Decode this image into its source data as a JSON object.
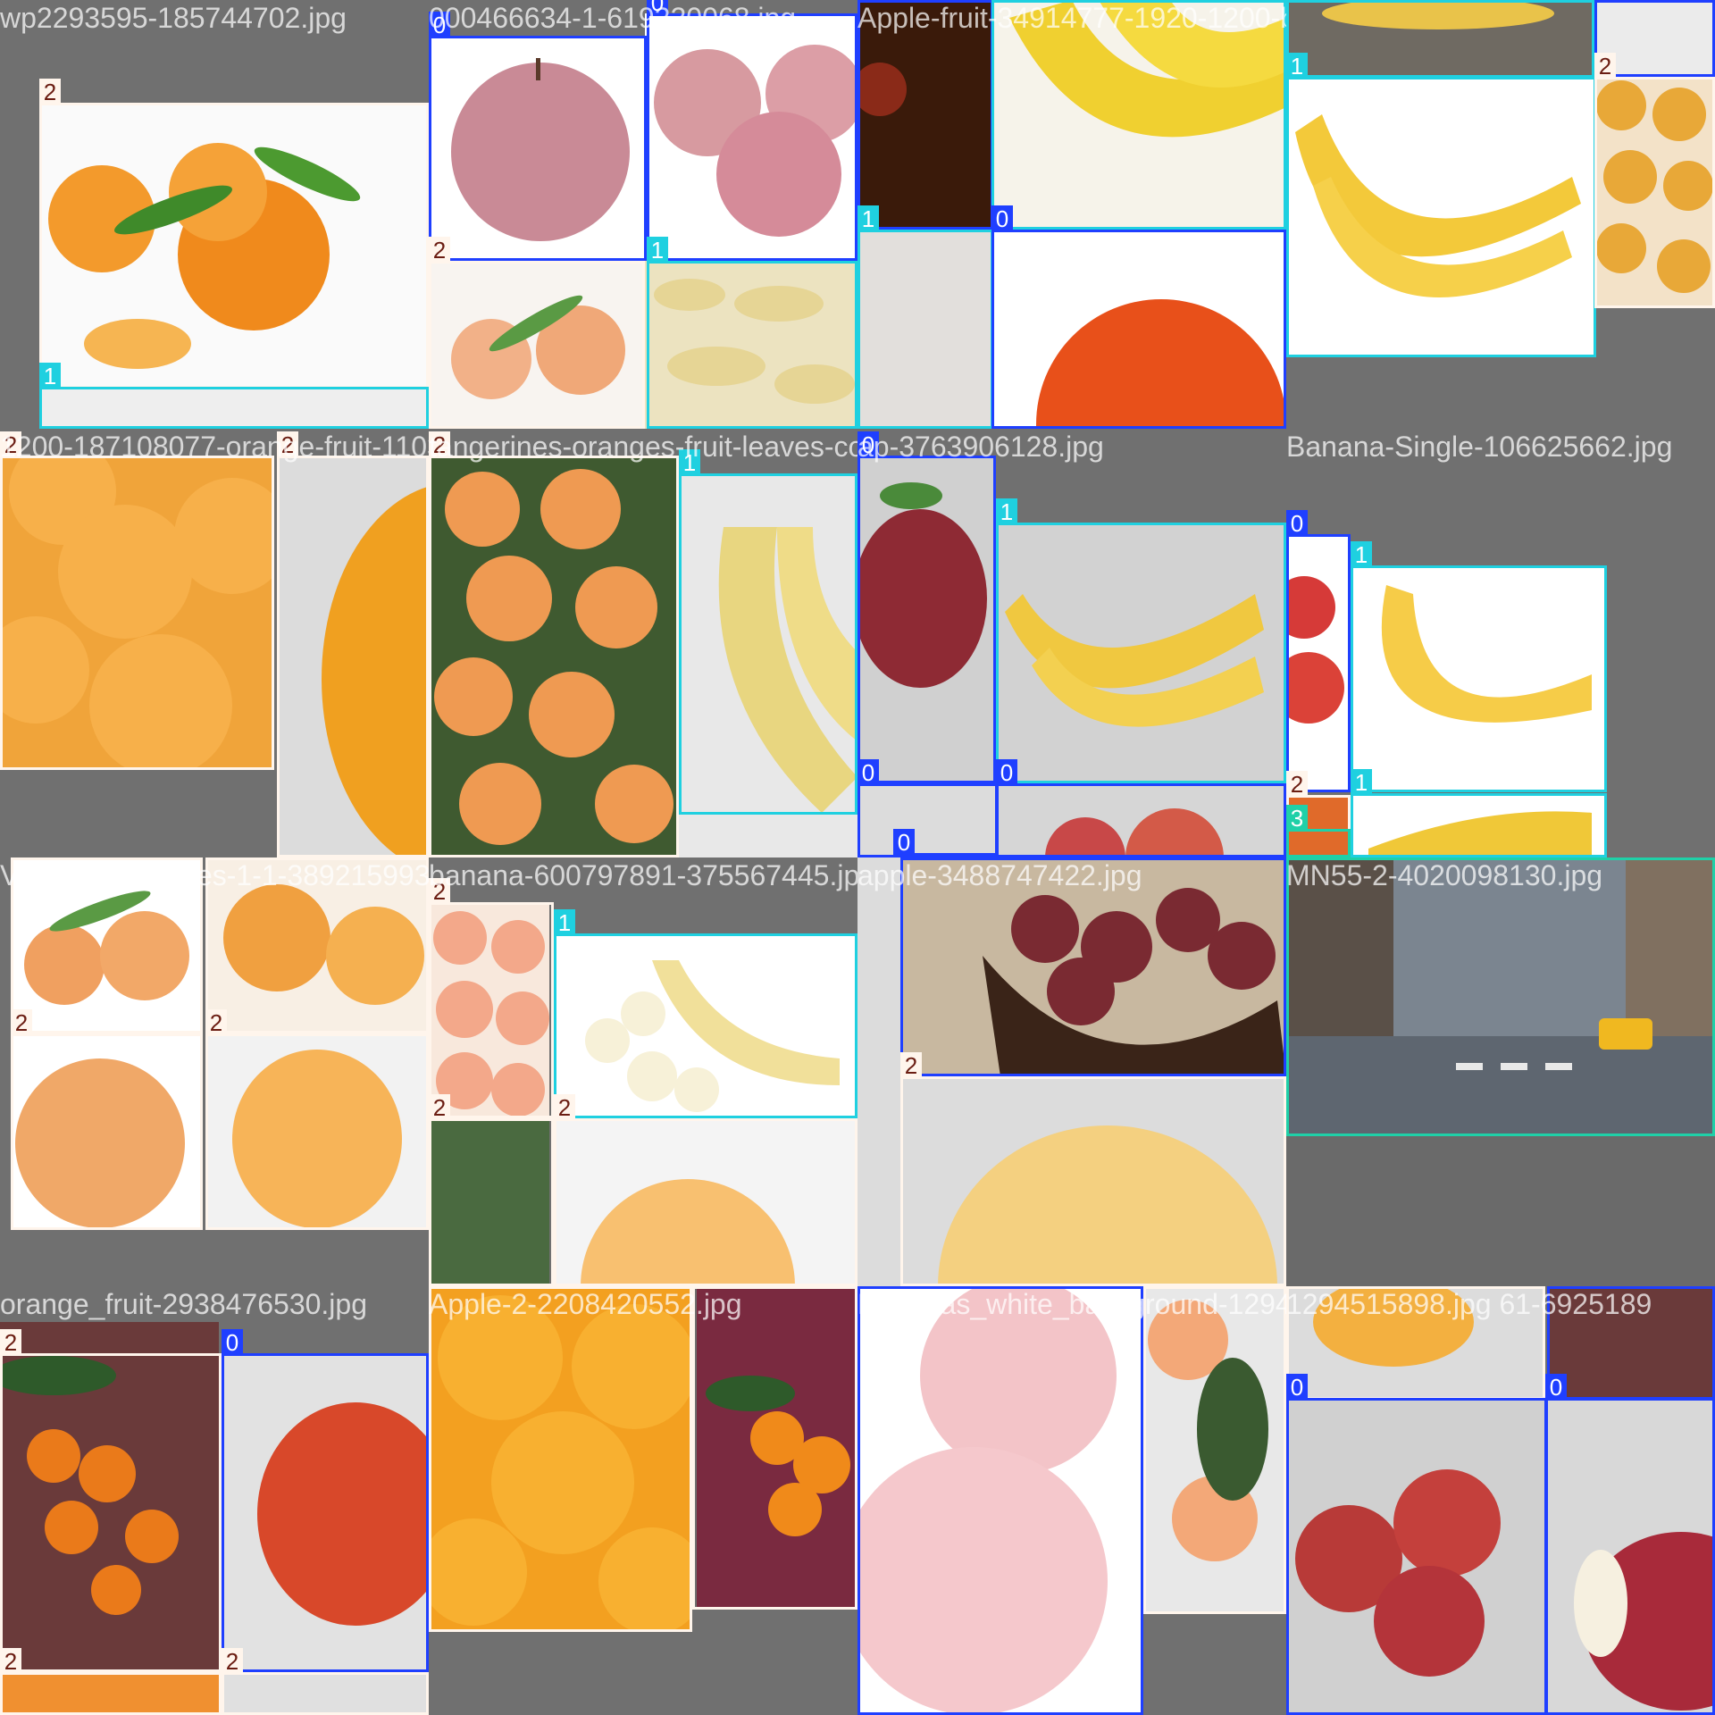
{
  "classes": {
    "0": {
      "label": "0",
      "color": "#1f3fff",
      "meaning": "apple"
    },
    "1": {
      "label": "1",
      "color": "#1fd0e0",
      "meaning": "banana"
    },
    "2": {
      "label": "2",
      "color": "#fff5ec",
      "meaning": "orange"
    },
    "3": {
      "label": "3",
      "color": "#1fd0a8",
      "meaning": "other"
    }
  },
  "tiles": [
    {
      "filename": "wp2293595-185744702.jpg",
      "row": 0,
      "col": 0
    },
    {
      "filename": "000466634-1-619220068.jpg",
      "row": 0,
      "col": 1
    },
    {
      "filename": "Apple-fruit-34914777-1920-1200-bananas-2702100.jpg",
      "row": 0,
      "col": 2
    },
    {
      "filename": "",
      "row": 0,
      "col": 3
    },
    {
      "filename": "1200-187108077-orange-fruit-1103748177.jpg",
      "row": 1,
      "col": 0
    },
    {
      "filename": "tangerines-oranges-fruit-leaves-compote",
      "row": 1,
      "col": 1
    },
    {
      "filename": "ap-3763906128.jpg",
      "row": 1,
      "col": 2
    },
    {
      "filename": "Banana-Single-106625662.jpg",
      "row": 1,
      "col": 3
    },
    {
      "filename": "Valencia-Oranges-1-1-3892159934.jpg",
      "row": 2,
      "col": 0
    },
    {
      "filename": "banana-600797891-375567445.jpg",
      "row": 2,
      "col": 1
    },
    {
      "filename": "apple-3488747422.jpg",
      "row": 2,
      "col": 2
    },
    {
      "filename": "MN55-2-4020098130.jpg",
      "row": 2,
      "col": 3
    },
    {
      "filename": "orange_fruit-2938476530.jpg",
      "row": 3,
      "col": 0
    },
    {
      "filename": "Apple-2-2208420552.jpg",
      "row": 3,
      "col": 1
    },
    {
      "filename": "Bananas_white_background-1294515898.jpg",
      "row": 3,
      "col": 2
    },
    {
      "filename": "1294515898.jpg 61-6925189",
      "row": 3,
      "col": 3
    }
  ],
  "boxes": [
    {
      "cls": "2"
    },
    {
      "cls": "1"
    },
    {
      "cls": "0"
    },
    {
      "cls": "0"
    },
    {
      "cls": "2"
    },
    {
      "cls": "1"
    },
    {
      "cls": "0"
    },
    {
      "cls": "1"
    },
    {
      "cls": "1"
    },
    {
      "cls": "0"
    },
    {
      "cls": "1"
    },
    {
      "cls": "1"
    },
    {
      "cls": "0"
    },
    {
      "cls": "2"
    },
    {
      "cls": "2"
    },
    {
      "cls": "2"
    },
    {
      "cls": "2"
    },
    {
      "cls": "1"
    },
    {
      "cls": "0"
    },
    {
      "cls": "1"
    },
    {
      "cls": "0"
    },
    {
      "cls": "0"
    },
    {
      "cls": "0"
    },
    {
      "cls": "0"
    },
    {
      "cls": "1"
    },
    {
      "cls": "1"
    },
    {
      "cls": "2"
    },
    {
      "cls": "3"
    },
    {
      "cls": "2"
    },
    {
      "cls": "2"
    },
    {
      "cls": "2"
    },
    {
      "cls": "2"
    },
    {
      "cls": "2"
    },
    {
      "cls": "1"
    },
    {
      "cls": "2"
    },
    {
      "cls": "2"
    },
    {
      "cls": "0"
    },
    {
      "cls": "2"
    },
    {
      "cls": "3"
    },
    {
      "cls": "2"
    },
    {
      "cls": "0"
    },
    {
      "cls": "2"
    },
    {
      "cls": "2"
    },
    {
      "cls": "2"
    },
    {
      "cls": "2"
    },
    {
      "cls": "0"
    },
    {
      "cls": "2"
    },
    {
      "cls": "2"
    },
    {
      "cls": "0"
    },
    {
      "cls": "0"
    },
    {
      "cls": "0"
    }
  ]
}
